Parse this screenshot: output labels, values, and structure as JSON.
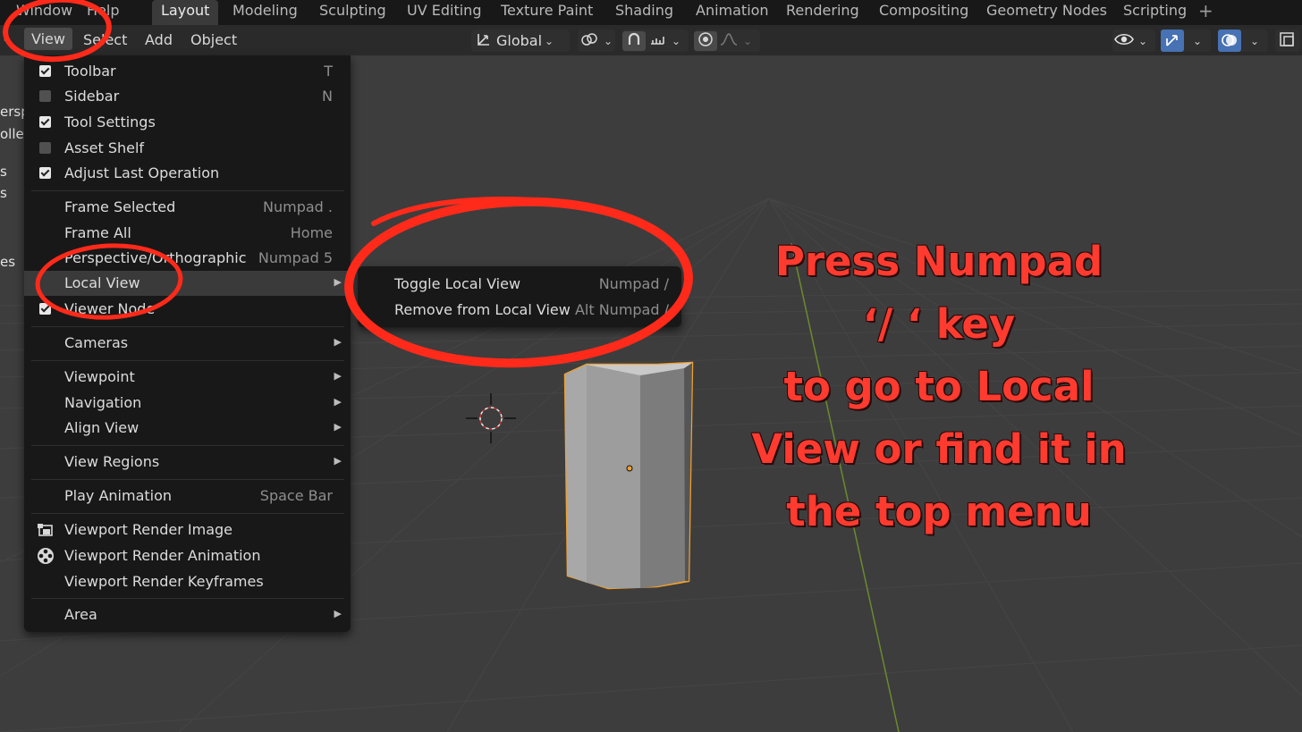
{
  "topbar": {
    "menus": [
      "Window",
      "Help"
    ],
    "tabs": [
      "Layout",
      "Modeling",
      "Sculpting",
      "UV Editing",
      "Texture Paint",
      "Shading",
      "Animation",
      "Rendering",
      "Compositing",
      "Geometry Nodes",
      "Scripting"
    ],
    "active_tab": "Layout",
    "add_label": "+"
  },
  "header": {
    "menus": [
      "View",
      "Select",
      "Add",
      "Object"
    ],
    "transform_orientation": "Global",
    "icons": [
      "transform-orientation-icon",
      "pivot-icon",
      "snap-icon",
      "snap-increment-icon",
      "proportional-edit-icon",
      "falloff-icon",
      "visibility-icon",
      "gizmo-icon",
      "overlay-icon",
      "xray-icon"
    ]
  },
  "side_fragments": [
    "ersp",
    "ollec",
    "s",
    "s",
    "es"
  ],
  "view_menu": {
    "items": [
      {
        "label": "Toolbar",
        "shortcut": "T",
        "checkbox": true,
        "checked": true
      },
      {
        "label": "Sidebar",
        "shortcut": "N",
        "checkbox": true,
        "checked": false
      },
      {
        "label": "Tool Settings",
        "shortcut": "",
        "checkbox": true,
        "checked": true
      },
      {
        "label": "Asset Shelf",
        "shortcut": "",
        "checkbox": true,
        "checked": false
      },
      {
        "label": "Adjust Last Operation",
        "shortcut": "",
        "checkbox": true,
        "checked": true
      },
      {
        "label": "Frame Selected",
        "shortcut": "Numpad ."
      },
      {
        "label": "Frame All",
        "shortcut": "Home"
      },
      {
        "label": "Perspective/Orthographic",
        "shortcut": "Numpad 5"
      },
      {
        "label": "Local View",
        "shortcut": "",
        "submenu": true
      },
      {
        "label": "Viewer Node",
        "shortcut": "",
        "checkbox": true,
        "checked": true
      },
      {
        "label": "Cameras",
        "submenu": true
      },
      {
        "label": "Viewpoint",
        "submenu": true
      },
      {
        "label": "Navigation",
        "submenu": true
      },
      {
        "label": "Align View",
        "submenu": true
      },
      {
        "label": "View Regions",
        "submenu": true
      },
      {
        "label": "Play Animation",
        "shortcut": "Space Bar"
      },
      {
        "label": "Viewport Render Image",
        "icon": "render-image-icon"
      },
      {
        "label": "Viewport Render Animation",
        "icon": "render-animation-icon"
      },
      {
        "label": "Viewport Render Keyframes"
      },
      {
        "label": "Area",
        "submenu": true
      }
    ]
  },
  "local_view_submenu": {
    "items": [
      {
        "label": "Toggle Local View",
        "shortcut": "Numpad /"
      },
      {
        "label": "Remove from Local View",
        "shortcut": "Alt Numpad /"
      }
    ]
  },
  "annotation": {
    "lines": [
      "Press Numpad",
      "‘/ ‘ key",
      "to go to Local",
      "View or find it in",
      "the top menu"
    ],
    "color": "#ff3b30"
  },
  "colors": {
    "accent_blue": "#4772b3",
    "selection_orange": "#f0a030",
    "menu_bg": "#181818",
    "annotation_red": "#ff3b30"
  }
}
